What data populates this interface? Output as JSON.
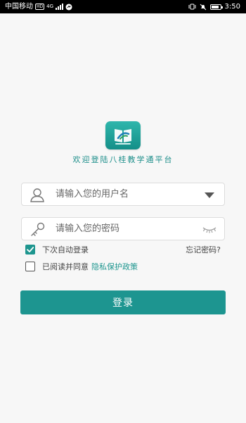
{
  "status_bar": {
    "carrier": "中国移动",
    "hd_badge": "HD",
    "network_type": "4G",
    "battery_percent": 80,
    "time": "3:50"
  },
  "app": {
    "welcome_text": "欢迎登陆八桂教学通平台"
  },
  "form": {
    "username_placeholder": "请输入您的用户名",
    "password_placeholder": "请输入您的密码",
    "auto_login_label": "下次自动登录",
    "auto_login_checked": true,
    "forgot_password_label": "忘记密码?",
    "agree_label": "已阅读并同意",
    "agree_checked": false,
    "privacy_link_label": "隐私保护政策",
    "login_button_label": "登录"
  },
  "colors": {
    "accent": "#1d9590",
    "background": "#f7f7f7"
  },
  "icons": {
    "username_field": "user-icon",
    "password_field": "key-icon",
    "dropdown": "dropdown-triangle-icon",
    "password_toggle": "eye-closed-icon"
  }
}
